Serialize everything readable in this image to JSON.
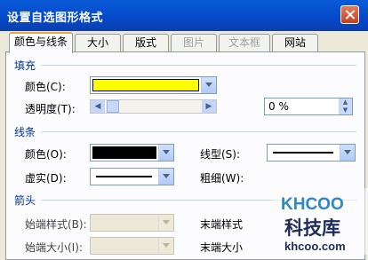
{
  "dialog": {
    "title": "设置自选图形格式"
  },
  "tabs": [
    {
      "label": "颜色与线条",
      "active": true,
      "disabled": false
    },
    {
      "label": "大小",
      "active": false,
      "disabled": false
    },
    {
      "label": "版式",
      "active": false,
      "disabled": false
    },
    {
      "label": "图片",
      "active": false,
      "disabled": true
    },
    {
      "label": "文本框",
      "active": false,
      "disabled": true
    },
    {
      "label": "网站",
      "active": false,
      "disabled": false
    }
  ],
  "fill": {
    "section_label": "填充",
    "color_label": "颜色(C):",
    "color_value": "#ffff00",
    "transparency_label": "透明度(T):",
    "transparency_value": "0 %"
  },
  "line": {
    "section_label": "线条",
    "color_label": "颜色(O):",
    "color_value": "#000000",
    "style_label": "线型(S):",
    "dash_label": "虚实(D):",
    "weight_label": "粗细(W):"
  },
  "arrows": {
    "section_label": "箭头",
    "begin_style_label": "始端样式(B):",
    "begin_size_label": "始端大小(I):",
    "end_style_label": "末端样式",
    "end_size_label": "末端大小"
  },
  "watermark": {
    "brand": "KHCOO",
    "name": "科技库",
    "domain": "khcoo.com"
  }
}
